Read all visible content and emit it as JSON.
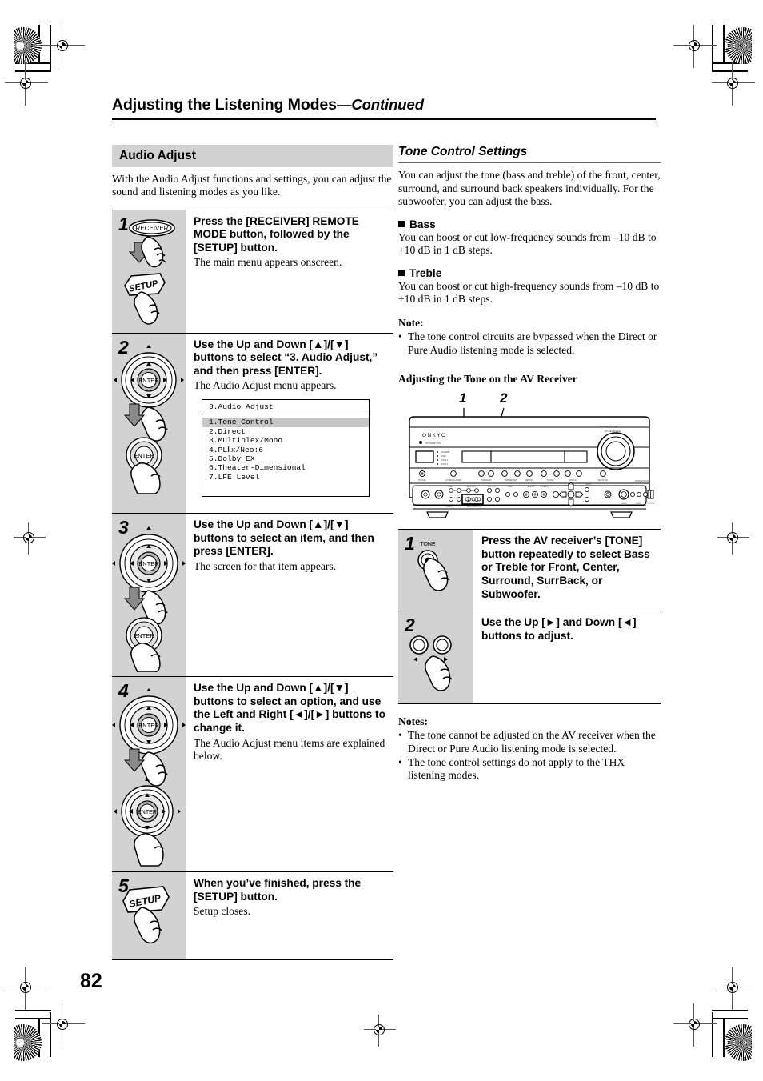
{
  "page": {
    "number": "82",
    "header_title": "Adjusting the Listening Modes",
    "header_continued": "—Continued"
  },
  "left_column": {
    "section_heading": "Audio Adjust",
    "intro": "With the Audio Adjust functions and settings, you can adjust the sound and listening modes as you like.",
    "steps": [
      {
        "number": "1",
        "heading": "Press the [RECEIVER] REMOTE MODE button, followed by the [SETUP] button.",
        "body": "The main menu appears onscreen.",
        "art": "receiver-setup-buttons",
        "button_labels": [
          "RECEIVER",
          "SETUP"
        ]
      },
      {
        "number": "2",
        "heading": "Use the Up and Down [▲]/[▼] buttons to select “3. Audio Adjust,” and then press [ENTER].",
        "body": "The Audio Adjust menu appears.",
        "art": "dpad-enter-buttons",
        "button_labels": [
          "ENTER",
          "ENTER"
        ]
      },
      {
        "number": "3",
        "heading": "Use the Up and Down [▲]/[▼] buttons to select an item, and then press [ENTER].",
        "body": "The screen for that item appears.",
        "art": "dpad-enter-buttons",
        "button_labels": [
          "ENTER",
          "ENTER"
        ]
      },
      {
        "number": "4",
        "heading": "Use the Up and Down [▲]/[▼] buttons to select an option, and use the Left and Right [◄]/[►] buttons to change it.",
        "body": "The Audio Adjust menu items are explained below.",
        "art": "dpad-dpad-buttons",
        "button_labels": [
          "ENTER",
          "ENTER"
        ]
      },
      {
        "number": "5",
        "heading": "When you’ve finished, press the [SETUP] button.",
        "body": "Setup closes.",
        "art": "setup-button",
        "button_labels": [
          "SETUP"
        ]
      }
    ],
    "osd_menu": {
      "title": "3.Audio Adjust",
      "items": [
        "1.Tone Control",
        "2.Direct",
        "3.Multiplex/Mono",
        "4.PLⅡx/Neo:6",
        "5.Dolby EX",
        "6.Theater-Dimensional",
        "7.LFE Level"
      ],
      "selected_index": 0
    }
  },
  "right_column": {
    "section_heading": "Tone Control Settings",
    "intro": "You can adjust the tone (bass and treble) of the front, center, surround, and surround back speakers individually. For the subwoofer, you can adjust the bass.",
    "bass": {
      "heading": "Bass",
      "body": "You can boost or cut low-frequency sounds from –10 dB to +10 dB in 1 dB steps."
    },
    "treble": {
      "heading": "Treble",
      "body": "You can boost or cut high-frequency sounds from –10 dB to +10 dB in 1 dB steps."
    },
    "note_heading": "Note:",
    "note_items": [
      "The tone control circuits are bypassed when the Direct or Pure Audio listening mode is selected."
    ],
    "receiver_heading": "Adjusting the Tone on the AV Receiver",
    "receiver_brand": "ONKYO",
    "receiver_callouts": [
      "1",
      "2"
    ],
    "steps": [
      {
        "number": "1",
        "heading": "Press the AV receiver’s [TONE] button repeatedly to select Bass or Treble for Front, Center, Surround, SurrBack, or Subwoofer.",
        "art": "tone-button",
        "button_labels": [
          "TONE"
        ]
      },
      {
        "number": "2",
        "heading": "Use the Up [►] and Down [◄] buttons to adjust.",
        "art": "left-right-buttons",
        "button_labels": [
          "◄",
          "►"
        ]
      }
    ],
    "notes_heading": "Notes:",
    "notes_items": [
      "The tone cannot be adjusted on the AV receiver when the Direct or Pure Audio listening mode is selected.",
      "The tone control settings do not apply to the THX listening modes."
    ]
  },
  "colors": {
    "step_number_bg": "#d2d2d2",
    "section_bar_bg": "#d2d2d2",
    "osd_selected_bg": "#c6c6c6",
    "rule": "#000000"
  }
}
